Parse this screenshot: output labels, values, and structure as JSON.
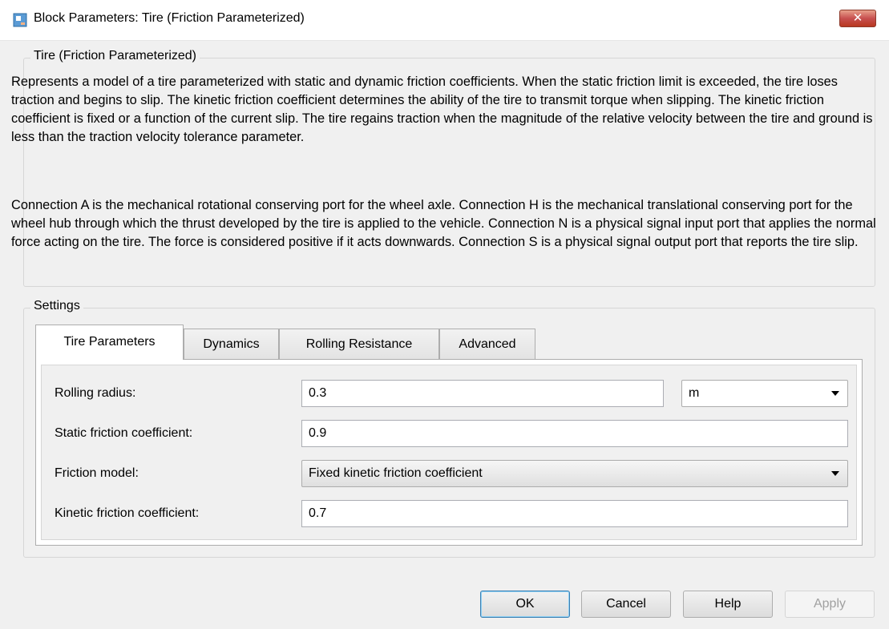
{
  "window": {
    "title": "Block Parameters: Tire (Friction Parameterized)",
    "close_symbol": "✕",
    "icons": {
      "app": "simulink-block-icon",
      "close": "close-icon"
    }
  },
  "description_group": {
    "title": "Tire (Friction Parameterized)",
    "paragraph1": "Represents a model of a tire parameterized with static and dynamic friction coefficients. When the static friction limit is exceeded, the tire loses traction and begins to slip. The kinetic friction coefficient determines the ability of the tire to transmit torque when slipping. The kinetic friction coefficient is fixed or a function of the current slip. The tire regains traction when the magnitude of the relative velocity between the tire and ground is less than the traction velocity tolerance parameter.",
    "paragraph2": "Connection A is the mechanical rotational conserving port for the wheel axle. Connection H is the mechanical translational conserving port for the wheel hub through which the thrust developed by the tire is applied to the vehicle. Connection N is a physical signal input port that applies the normal force acting on the tire. The force is considered positive if it acts downwards. Connection S is a physical signal output port that reports the tire slip."
  },
  "settings": {
    "title": "Settings",
    "tabs": [
      {
        "label": "Tire Parameters",
        "active": true
      },
      {
        "label": "Dynamics",
        "active": false
      },
      {
        "label": "Rolling Resistance",
        "active": false
      },
      {
        "label": "Advanced",
        "active": false
      }
    ],
    "params": {
      "rolling_radius": {
        "label": "Rolling radius:",
        "value": "0.3",
        "unit": "m"
      },
      "static_friction": {
        "label": "Static friction coefficient:",
        "value": "0.9"
      },
      "friction_model": {
        "label": "Friction model:",
        "value": "Fixed kinetic friction coefficient"
      },
      "kinetic_friction": {
        "label": "Kinetic friction coefficient:",
        "value": "0.7"
      }
    }
  },
  "buttons": {
    "ok": "OK",
    "cancel": "Cancel",
    "help": "Help",
    "apply": "Apply",
    "apply_enabled": false
  },
  "colors": {
    "window_bg": "#f0f0f0",
    "close_button": "#c75050",
    "default_button_border": "#3c7fb1"
  }
}
